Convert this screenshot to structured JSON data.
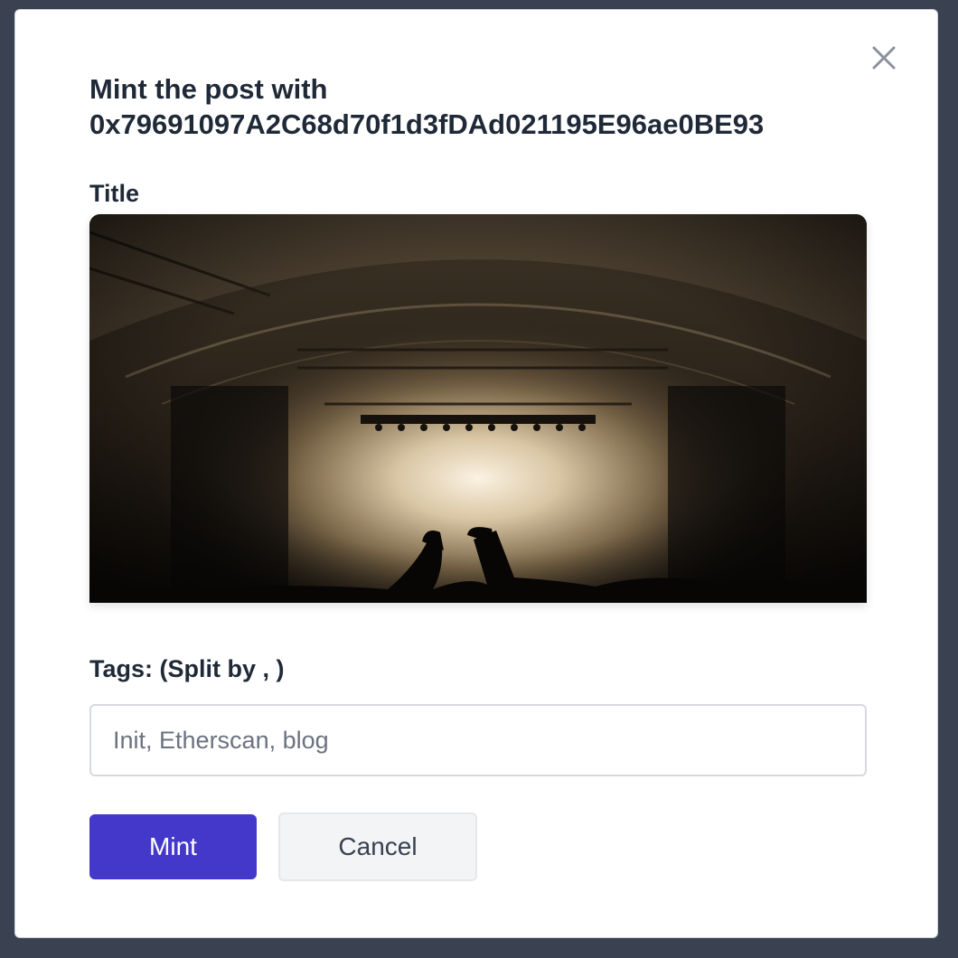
{
  "modal": {
    "title": "Mint the post with 0x79691097A2C68d70f1d3fDAd021195E96ae0BE93",
    "close_icon": "close-icon",
    "title_label": "Title",
    "image_description_icon": "concert-photo",
    "tags_label": "Tags: (Split by , )",
    "tags_input": {
      "value": "",
      "placeholder": "Init, Etherscan, blog"
    },
    "mint_label": "Mint",
    "cancel_label": "Cancel"
  },
  "colors": {
    "backdrop": "#3a4150",
    "primary": "#4338ca",
    "secondary": "#f3f4f6",
    "text": "#1f2937"
  }
}
